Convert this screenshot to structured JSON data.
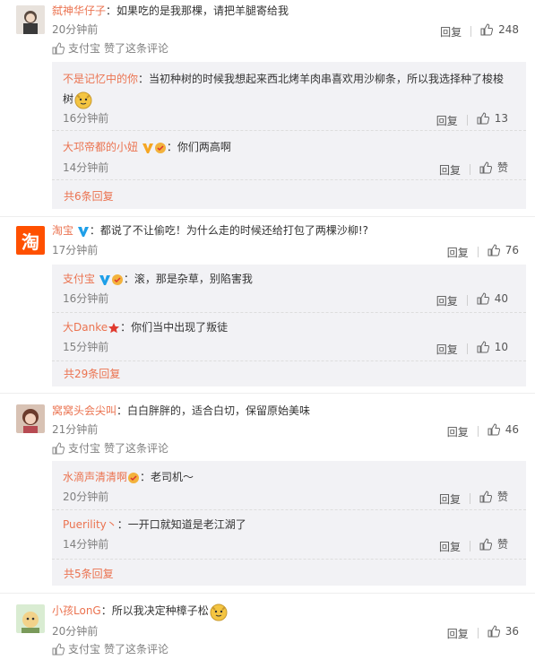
{
  "labels": {
    "reply": "回复",
    "like_text": "赞",
    "liked_this": "赞了这条评论"
  },
  "colors": {
    "username": "#eb7350",
    "reply_bg": "#f2f2f5",
    "text": "#333333",
    "muted": "#808080"
  },
  "comments": [
    {
      "user": "弑神华仔子",
      "text": "：如果吃的是我那棵，请把羊腿寄给我",
      "time": "20分钟前",
      "likes": "248",
      "liked_by": "支付宝",
      "avatar": "photo-avatar",
      "replies": [
        {
          "user": "不是记忆中的你",
          "text": "：当初种树的时候我想起来西北烤羊肉串喜欢用沙柳条，所以我选择种了梭梭",
          "text2": "树",
          "time": "16分钟前",
          "likes": "13",
          "emoji_icon": "doge-emoji"
        },
        {
          "user": "大邛帝都的小妞",
          "text": "：你们两高啊",
          "time": "14分钟前",
          "likes": "赞",
          "badges": [
            "vip-v-icon",
            "member-badge-icon"
          ]
        }
      ],
      "more": "共6条回复"
    },
    {
      "user": "淘宝",
      "text": "：都说了不让偷吃！为什么走的时候还给打包了两棵沙柳!?",
      "time": "17分钟前",
      "likes": "76",
      "avatar": "taobao-logo",
      "avatar_text": "淘",
      "replies": [
        {
          "user": "支付宝",
          "text": "：滚，那是杂草，别陷害我",
          "time": "16分钟前",
          "likes": "40",
          "badges": [
            "blue-v-icon",
            "member-badge-icon"
          ]
        },
        {
          "user": "大Danke",
          "text": "：你们当中出现了叛徒",
          "time": "15分钟前",
          "likes": "10",
          "badges": [
            "red-star-icon"
          ]
        }
      ],
      "more": "共29条回复"
    },
    {
      "user": "窝窝头会尖叫",
      "text": "：白白胖胖的，适合白切，保留原始美味",
      "time": "21分钟前",
      "likes": "46",
      "liked_by": "支付宝",
      "avatar": "photo-avatar",
      "replies": [
        {
          "user": "水滴声清清啊",
          "text": "：老司机～",
          "time": "20分钟前",
          "likes": "赞",
          "badges": [
            "member-badge-icon"
          ]
        },
        {
          "user": "Puerility丶",
          "text": "：一开口就知道是老江湖了",
          "time": "14分钟前",
          "likes": "赞"
        }
      ],
      "more": "共5条回复"
    },
    {
      "user": "小孩LonG",
      "text": "：所以我决定种樟子松",
      "time": "20分钟前",
      "likes": "36",
      "liked_by": "支付宝",
      "avatar": "cartoon-avatar",
      "emoji_icon": "doge-emoji"
    }
  ]
}
